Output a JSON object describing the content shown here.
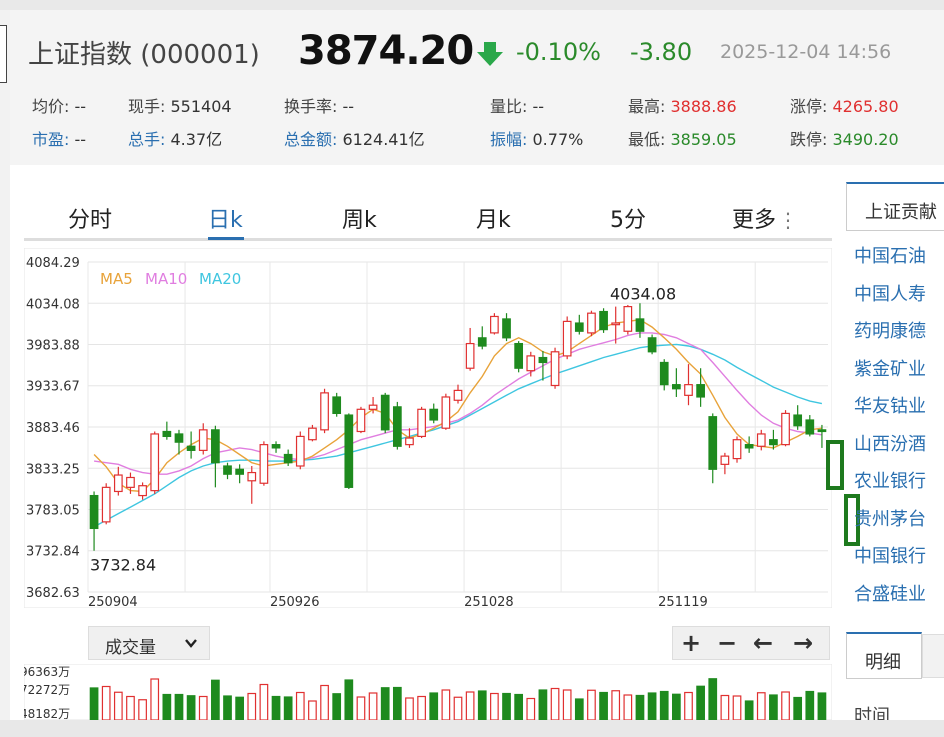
{
  "header": {
    "title": "上证指数 (000001)",
    "price": "3874.20",
    "pct_change": "-0.10%",
    "abs_change": "-3.80",
    "datetime": "2025-12-04 14:56",
    "stats": {
      "avg_label": "均价:",
      "avg_value": "--",
      "cur_vol_label": "现手:",
      "cur_vol_value": "551404",
      "turnover_label": "换手率:",
      "turnover_value": "--",
      "vol_ratio_label": "量比:",
      "vol_ratio_value": "--",
      "high_label": "最高:",
      "high_value": "3888.86",
      "limit_up_label": "涨停:",
      "limit_up_value": "4265.80",
      "pe_label": "市盈:",
      "pe_value": "--",
      "total_vol_label": "总手:",
      "total_vol_value": "4.37亿",
      "amount_label": "总金额:",
      "amount_value": "6124.41亿",
      "amplitude_label": "振幅:",
      "amplitude_value": "0.77%",
      "low_label": "最低:",
      "low_value": "3859.05",
      "limit_down_label": "跌停:",
      "limit_down_value": "3490.20"
    },
    "colors": {
      "up": "#e03030",
      "down": "#2a8a2a",
      "link": "#2a6fb0"
    }
  },
  "tabs": [
    "分时",
    "日k",
    "周k",
    "月k",
    "5分",
    "更多"
  ],
  "active_tab": "日k",
  "more_icon": "vertical-dots-icon",
  "right_panel": {
    "title": "上证贡献",
    "items": [
      "中国石油",
      "中国人寿",
      "药明康德",
      "紫金矿业",
      "华友钴业",
      "山西汾酒",
      "农业银行",
      "贵州茅台",
      "中国银行",
      "合盛硅业"
    ],
    "detail_tab": "明细",
    "time_label": "时间"
  },
  "volume_select": {
    "value": "成交量",
    "icon": "chevron-down-icon"
  },
  "controls": [
    {
      "label": "+",
      "icon": "zoom-in-icon"
    },
    {
      "label": "−",
      "icon": "zoom-out-icon"
    },
    {
      "label": "←",
      "icon": "arrow-left-icon"
    },
    {
      "label": "→",
      "icon": "arrow-right-icon"
    }
  ],
  "volume_axis_labels": [
    "96363万",
    "72272万",
    "48182万"
  ],
  "chart_data": {
    "type": "candlestick",
    "y_ticks": [
      "4084.29",
      "4034.08",
      "3983.88",
      "3933.67",
      "3883.46",
      "3833.25",
      "3783.05",
      "3732.84",
      "3682.63"
    ],
    "ylim": [
      3682.63,
      4084.29
    ],
    "x_tick_labels": [
      {
        "label": "250904",
        "index": 0
      },
      {
        "label": "250926",
        "index": 15
      },
      {
        "label": "251028",
        "index": 31
      },
      {
        "label": "251119",
        "index": 47
      }
    ],
    "annotations": [
      {
        "text": "4034.08",
        "index": 45,
        "value": 4034.08
      },
      {
        "text": "3732.84",
        "index": 0,
        "value": 3732.84
      }
    ],
    "legend": [
      {
        "name": "MA5",
        "color": "#e8a33a"
      },
      {
        "name": "MA10",
        "color": "#e07ee0"
      },
      {
        "name": "MA20",
        "color": "#3fc6e0"
      }
    ],
    "candles": [
      [
        3800,
        3760,
        3805,
        3732.84
      ],
      [
        3768,
        3810,
        3815,
        3765
      ],
      [
        3805,
        3825,
        3835,
        3800
      ],
      [
        3810,
        3822,
        3828,
        3802
      ],
      [
        3800,
        3812,
        3816,
        3795
      ],
      [
        3806,
        3875,
        3878,
        3802
      ],
      [
        3878,
        3872,
        3890,
        3868
      ],
      [
        3875,
        3865,
        3880,
        3850
      ],
      [
        3860,
        3855,
        3878,
        3845
      ],
      [
        3855,
        3880,
        3888,
        3850
      ],
      [
        3880,
        3840,
        3885,
        3810
      ],
      [
        3836,
        3826,
        3840,
        3820
      ],
      [
        3832,
        3826,
        3838,
        3815
      ],
      [
        3818,
        3828,
        3836,
        3790
      ],
      [
        3815,
        3862,
        3866,
        3812
      ],
      [
        3862,
        3858,
        3866,
        3852
      ],
      [
        3850,
        3840,
        3856,
        3836
      ],
      [
        3836,
        3872,
        3878,
        3832
      ],
      [
        3868,
        3882,
        3886,
        3866
      ],
      [
        3880,
        3925,
        3930,
        3876
      ],
      [
        3920,
        3900,
        3925,
        3896
      ],
      [
        3898,
        3810,
        3900,
        3808
      ],
      [
        3878,
        3905,
        3908,
        3876
      ],
      [
        3905,
        3910,
        3920,
        3900
      ],
      [
        3922,
        3880,
        3925,
        3876
      ],
      [
        3908,
        3860,
        3914,
        3856
      ],
      [
        3862,
        3870,
        3882,
        3858
      ],
      [
        3872,
        3905,
        3908,
        3870
      ],
      [
        3905,
        3892,
        3912,
        3888
      ],
      [
        3882,
        3920,
        3924,
        3880
      ],
      [
        3916,
        3928,
        3935,
        3912
      ],
      [
        3955,
        3985,
        4004,
        3952
      ],
      [
        3992,
        3982,
        4006,
        3978
      ],
      [
        3998,
        4018,
        4022,
        3996
      ],
      [
        4015,
        3992,
        4022,
        3988
      ],
      [
        3985,
        3955,
        3988,
        3950
      ],
      [
        3952,
        3970,
        3975,
        3945
      ],
      [
        3968,
        3962,
        3976,
        3940
      ],
      [
        3934,
        3975,
        3980,
        3930
      ],
      [
        3970,
        4012,
        4018,
        3966
      ],
      [
        4010,
        4000,
        4020,
        3996
      ],
      [
        3998,
        4022,
        4025,
        3994
      ],
      [
        4024,
        4002,
        4028,
        3998
      ],
      [
        4008,
        4010,
        4030,
        3985
      ],
      [
        4000,
        4030,
        4032,
        3996
      ],
      [
        4015,
        4000,
        4034.08,
        3992
      ],
      [
        3992,
        3975,
        3996,
        3972
      ],
      [
        3962,
        3935,
        3966,
        3928
      ],
      [
        3935,
        3930,
        3955,
        3920
      ],
      [
        3922,
        3935,
        3960,
        3910
      ],
      [
        3935,
        3920,
        3955,
        3908
      ],
      [
        3896,
        3832,
        3900,
        3815
      ],
      [
        3838,
        3848,
        3852,
        3826
      ],
      [
        3845,
        3868,
        3872,
        3840
      ],
      [
        3862,
        3858,
        3872,
        3852
      ],
      [
        3860,
        3875,
        3880,
        3855
      ],
      [
        3868,
        3862,
        3880,
        3856
      ],
      [
        3862,
        3900,
        3904,
        3860
      ],
      [
        3898,
        3885,
        3910,
        3880
      ],
      [
        3892,
        3875,
        3898,
        3872
      ],
      [
        3880,
        3878,
        3886,
        3858
      ]
    ],
    "ma5": [
      3850,
      3835,
      3815,
      3806,
      3805,
      3820,
      3840,
      3852,
      3862,
      3870,
      3868,
      3860,
      3850,
      3840,
      3836,
      3838,
      3840,
      3842,
      3848,
      3858,
      3868,
      3880,
      3895,
      3905,
      3900,
      3880,
      3870,
      3875,
      3882,
      3890,
      3902,
      3925,
      3945,
      3970,
      3985,
      3992,
      3985,
      3975,
      3970,
      3975,
      3985,
      3995,
      4005,
      4010,
      4012,
      4014,
      4005,
      3992,
      3978,
      3962,
      3948,
      3922,
      3895,
      3875,
      3862,
      3860,
      3858,
      3865,
      3872,
      3880,
      3882
    ],
    "ma10": [
      3842,
      3840,
      3838,
      3832,
      3828,
      3826,
      3826,
      3830,
      3836,
      3845,
      3852,
      3855,
      3858,
      3856,
      3852,
      3848,
      3845,
      3844,
      3846,
      3850,
      3856,
      3862,
      3868,
      3872,
      3876,
      3880,
      3880,
      3882,
      3884,
      3888,
      3892,
      3900,
      3910,
      3922,
      3932,
      3942,
      3950,
      3958,
      3966,
      3972,
      3978,
      3982,
      3986,
      3990,
      3995,
      3998,
      3998,
      3996,
      3992,
      3985,
      3978,
      3962,
      3945,
      3928,
      3912,
      3898,
      3888,
      3882,
      3878,
      3876,
      3874
    ],
    "ma20": [
      3762,
      3770,
      3778,
      3786,
      3794,
      3802,
      3812,
      3822,
      3830,
      3836,
      3840,
      3842,
      3843,
      3843,
      3842,
      3842,
      3842,
      3843,
      3844,
      3846,
      3848,
      3852,
      3856,
      3860,
      3864,
      3868,
      3872,
      3876,
      3880,
      3885,
      3890,
      3898,
      3906,
      3914,
      3922,
      3930,
      3936,
      3942,
      3948,
      3953,
      3958,
      3963,
      3968,
      3972,
      3976,
      3980,
      3982,
      3983,
      3984,
      3982,
      3978,
      3972,
      3965,
      3956,
      3948,
      3940,
      3932,
      3926,
      3920,
      3915,
      3912
    ]
  }
}
